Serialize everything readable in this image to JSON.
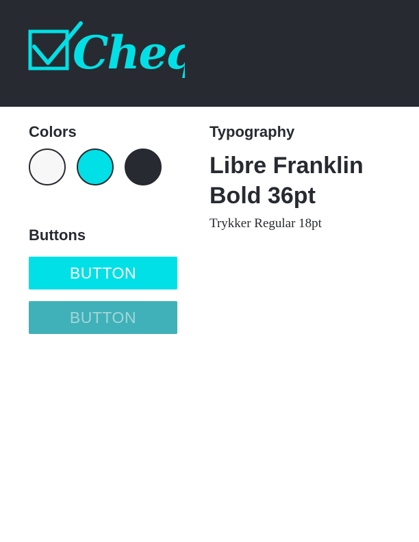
{
  "brand": {
    "name": "Cheq",
    "logo_icon": "checkbox-icon"
  },
  "colors": {
    "title": "Colors",
    "palette": [
      "#f7f7f7",
      "#00e0e6",
      "#272a30"
    ],
    "header_background": "#272a30"
  },
  "buttons": {
    "title": "Buttons",
    "primary": {
      "label": "BUTTON",
      "background": "#00e0e6",
      "text_color": "#ffffff"
    },
    "secondary": {
      "label": "BUTTON",
      "background": "#40b1b8",
      "text_color": "#a3d6da"
    }
  },
  "typography": {
    "title": "Typography",
    "heading_sample": "Libre Franklin Bold 36pt",
    "body_sample": "Trykker Regular 18pt"
  }
}
